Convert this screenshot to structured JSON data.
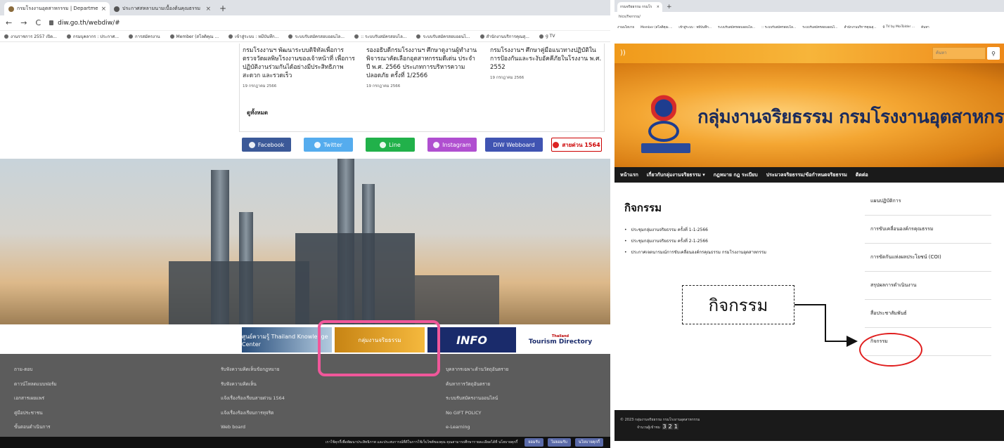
{
  "left": {
    "tabs": [
      {
        "label": "กรมโรงงานอุตสาหกรรม | Departme"
      },
      {
        "label": "ประกาศสหลามนามเบื้องต้นคุณธรรม"
      }
    ],
    "new_tab": "+",
    "url": "diw.go.th/webdiw/#",
    "bookmarks": [
      "งานราชการ 2557 เปิด...",
      "กรมบุคลากร : ประกาศ...",
      "การสมัครงาน",
      "Member (สโลติคุณ ...",
      "เข้าสู่ระบบ : หมีบันทึก...",
      "ระบบรับสมัครสอบออนไล...",
      ":: ระบบรับสมัครสอบไล...",
      "ระบบรับสมัครสอบออนไ...",
      "สำนักงานบริการคุณสุ...",
      "g TV"
    ],
    "news": [
      {
        "text": "กรมโรงงานฯ พัฒนาระบบดิจิทัลเพื่อการตรวจวัดผลพิษโรงงานของเจ้าหน้าที่ เพื่อการปฏิบัติงานร่วมกันได้อย่างมีประสิทธิภาพ สะดวก และรวดเร็ว",
        "date": "19 กรกฎาคม 2566"
      },
      {
        "text": "รองอธิบดีกรมโรงงานฯ ศึกษาดูงานผู้ทำงานพิจารณาคัดเลือกอุตสาหกรรมดีเด่น ประจำปี พ.ศ. 2566 ประเภทการบริหารความปลอดภัย ครั้งที่ 1/2566",
        "date": "19 กรกฎาคม 2566"
      },
      {
        "text": "กรมโรงงานฯ ศึกษาคู่มือแนวทางปฏิบัติในการป้องกันและระงับอัคคีภัยในโรงงาน พ.ศ. 2552",
        "date": "19 กรกฎาคม 2566"
      }
    ],
    "see_all": "ดูทั้งหมด",
    "social": [
      "Facebook",
      "Twitter",
      "Line",
      "Instagram",
      "DIW Webboard",
      "สายด่วน 1564"
    ],
    "banners": {
      "knowledge": "ศูนย์ความรู้ Thailand Knowledge Center",
      "ethics": "กลุ่มงานจริยธรรม",
      "info": "INFO",
      "tourism": "Tourism Directory",
      "thailand": "Thailand"
    },
    "footer": {
      "col1": [
        "ถาม-ตอบ",
        "ดาวน์โหลดแบบฟอร์ม",
        "เอกสารเผยแพร่",
        "คู่มือประชาชน",
        "ขั้นตอนดำเนินการ"
      ],
      "col2": [
        "รับฟังความคิดเห็นข้อกฎหมาย",
        "รับฟังความคิดเห็น",
        "แจ้งเรื่องร้องเรียนสายด่วน 1564",
        "แจ้งเรื่องร้องเรียนการทุจริต",
        "Web board"
      ],
      "col3": [
        "บุคลากรเฉพาะด้านวัตถุอันตราย",
        "ค้นหาการวัตถุอันตราย",
        "ระบบรับสมัครงานออนไลน์",
        "No GIFT POLICY",
        "e-Learning"
      ]
    },
    "cookie": {
      "text": "เราใช้คุกกี้เพื่อพัฒนาประสิทธิภาพ และประสบการณ์ที่ดีในการใช้เว็บไซต์ของคุณ คุณสามารถศึกษารายละเอียดได้ที่ นโยบายคุกกี้",
      "accept": "ยอมรับ",
      "reject": "ไม่ยอมรับ",
      "settings": "นโยบายคุกกี้"
    }
  },
  "right": {
    "tab": "กรมจริยธรรม กรมโร",
    "new_tab": "+",
    "url": "hics/กิจกรรม/",
    "bookmarks": [
      "งานนโยบาย",
      "Member (สโลติคุณ ...",
      "เข้าสู่ระบบ : หมีบันทึก...",
      "ระบบรับสมัครสอบออนไล...",
      ":: ระบบรับสมัครสอบไล...",
      "ระบบรับสมัครสอบออนไ...",
      "สำนักงานบริการคุณสุ...",
      "g TV by MoiTolder ...",
      "ค้นหา"
    ],
    "search_placeholder": "ค้นหา",
    "title": "กลุ่มงานจริยธรรม กรมโรงงานอุตสาหกรรม",
    "nav": [
      "หน้าแรก",
      "เกี่ยวกับกลุ่มงานจริยธรรม ▾",
      "กฎหมาย กฎ ระเบียบ",
      "ประมวลจริยธรรม/ข้อกำหนดจริยธรรม",
      "ติดต่อ"
    ],
    "heading": "กิจกรรม",
    "list": [
      "ประชุมกลุ่มงานจริยธรรม ครั้งที่ 1-1-2566",
      "ประชุมกลุ่มงานจริยธรรม ครั้งที่ 2-1-2566",
      "ประกาศเจตนารมณ์การขับเคลื่อนองค์กรคุณธรรม กรมโรงงานอุตสาหกรรม"
    ],
    "sidebar": [
      "แผนปฏิบัติการ",
      "การขับเคลื่อนองค์กรคุณธรรม",
      "การขัดกันแห่งผลประโยชน์ (COI)",
      "สรุปผลการดำเนินงาน",
      "สื่อประชาสัมพันธ์",
      "กิจกรรม"
    ],
    "callout": "กิจกรรม",
    "footer": {
      "copyright": "© 2023 กลุ่มงานจริยธรรม กรมโรงงานอุตสาหกรรม",
      "visitors": "จำนวนผู้เข้าชม",
      "digits": [
        "3",
        "2",
        "1"
      ]
    }
  },
  "colors": {
    "facebook": "#3b5998",
    "twitter": "#55acee",
    "line": "#21b14a",
    "instagram": "#b04fd0",
    "webboard": "#4054b2",
    "highlight_pink": "#f0579a",
    "highlight_red": "#e01e1e"
  }
}
